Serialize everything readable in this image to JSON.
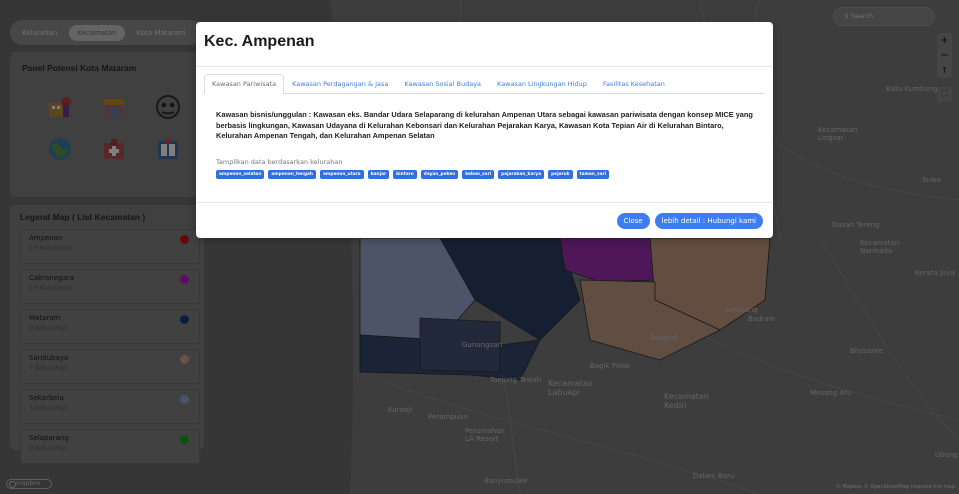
{
  "level_tabs": {
    "kelurahan": "Kelurahan",
    "kecamatan": "Kecamatan",
    "kota": "Kota Mataram"
  },
  "potensi_panel": {
    "title": "Panel Potensi Kota Mataram"
  },
  "legend_panel": {
    "title": "Legend Map ( List Kecamatan )",
    "items": [
      {
        "name": "Ampenan",
        "count": "10 Kelurahan",
        "color": "#c21515"
      },
      {
        "name": "Cakranegara",
        "count": "10 Kelurahan",
        "color": "#b51ec6"
      },
      {
        "name": "Mataram",
        "count": "9 Kelurahan",
        "color": "#173d7d"
      },
      {
        "name": "Sandubaya",
        "count": "7 Kelurahan",
        "color": "#d8a489"
      },
      {
        "name": "Sekarbela",
        "count": "5 Kelurahan",
        "color": "#8fa9d9"
      },
      {
        "name": "Selaparang",
        "count": "9 Kelurahan",
        "color": "#18a524"
      }
    ]
  },
  "map": {
    "search_placeholder": "Search",
    "zoom_in": "+",
    "zoom_out": "−",
    "compass": "↑",
    "expand": "⛶",
    "labels": {
      "balu_kundong": "Batu Kumbung",
      "kec_lingsar": "Kecamatan\nLingsar",
      "suwe": "Suwe",
      "dasan_tereng": "Dasan Tereng",
      "kec_narmada": "Kecamatan\nNarmada",
      "kerata_jaya": "Kerata Jaya",
      "sekotong": "Sekotong",
      "badrain": "Badrain",
      "sengkol": "Sengkol",
      "bagik_polak": "Bagik Polak",
      "bilebante": "Bilebante",
      "tanjung_tewah": "Tanjung Tewah",
      "kec_labuapi": "Kecamatan\nLabuapi",
      "kec_kediri": "Kecamatan\nKediri",
      "mesang_aru": "Mesang Aru",
      "kuranji": "Kuranji",
      "perampuan": "Perampuan",
      "perumahan": "Perumahan\nLA Resort",
      "ubung": "Ubung",
      "banyumulek": "Banyumulek",
      "dalam_baru": "Dalam Baru",
      "gunungsari": "Gunungsari"
    },
    "attribution": "© Mapbox © OpenStreetMap Improve this map",
    "logo": "mapbox"
  },
  "modal": {
    "title": "Kec. Ampenan",
    "tabs": [
      {
        "label": "Kawasan Pariwisata",
        "active": true
      },
      {
        "label": "Kawasan Perdagangan & Jasa",
        "active": false
      },
      {
        "label": "Kawasan Sosial Budaya",
        "active": false
      },
      {
        "label": "Kawasan Lingkungan Hidup",
        "active": false
      },
      {
        "label": "Fasilitas Kesehatan",
        "active": false
      }
    ],
    "body": "Kawasan bisnis/unggulan : Kawasan eks. Bandar Udara Selaparang di kelurahan Ampenan Utara sebagai kawasan pariwisata dengan konsep MICE yang berbasis lingkungan, Kawasan Udayana di Kelurahan Kebonsari dan Kelurahan Pejarakan Karya, Kawasan Kota Tepian Air di Kelurahan Bintaro, Kelurahan Ampenan Tengah, dan Kelurahan Ampenan Selatan",
    "filter_label": "Tampilkan data berdasarkan kelurahan",
    "chips": [
      "ampenan_selatan",
      "ampenan_tengah",
      "ampenan_utara",
      "banjar",
      "bintaro",
      "dayan_peken",
      "kebon_sari",
      "pejarakan_karya",
      "pejeruk",
      "taman_sari"
    ],
    "close_label": "Close",
    "contact_label": "lebih detail : Hubungi kami"
  },
  "colors": {
    "accent": "#3d7df1",
    "tab_link": "#3f7ee8"
  }
}
